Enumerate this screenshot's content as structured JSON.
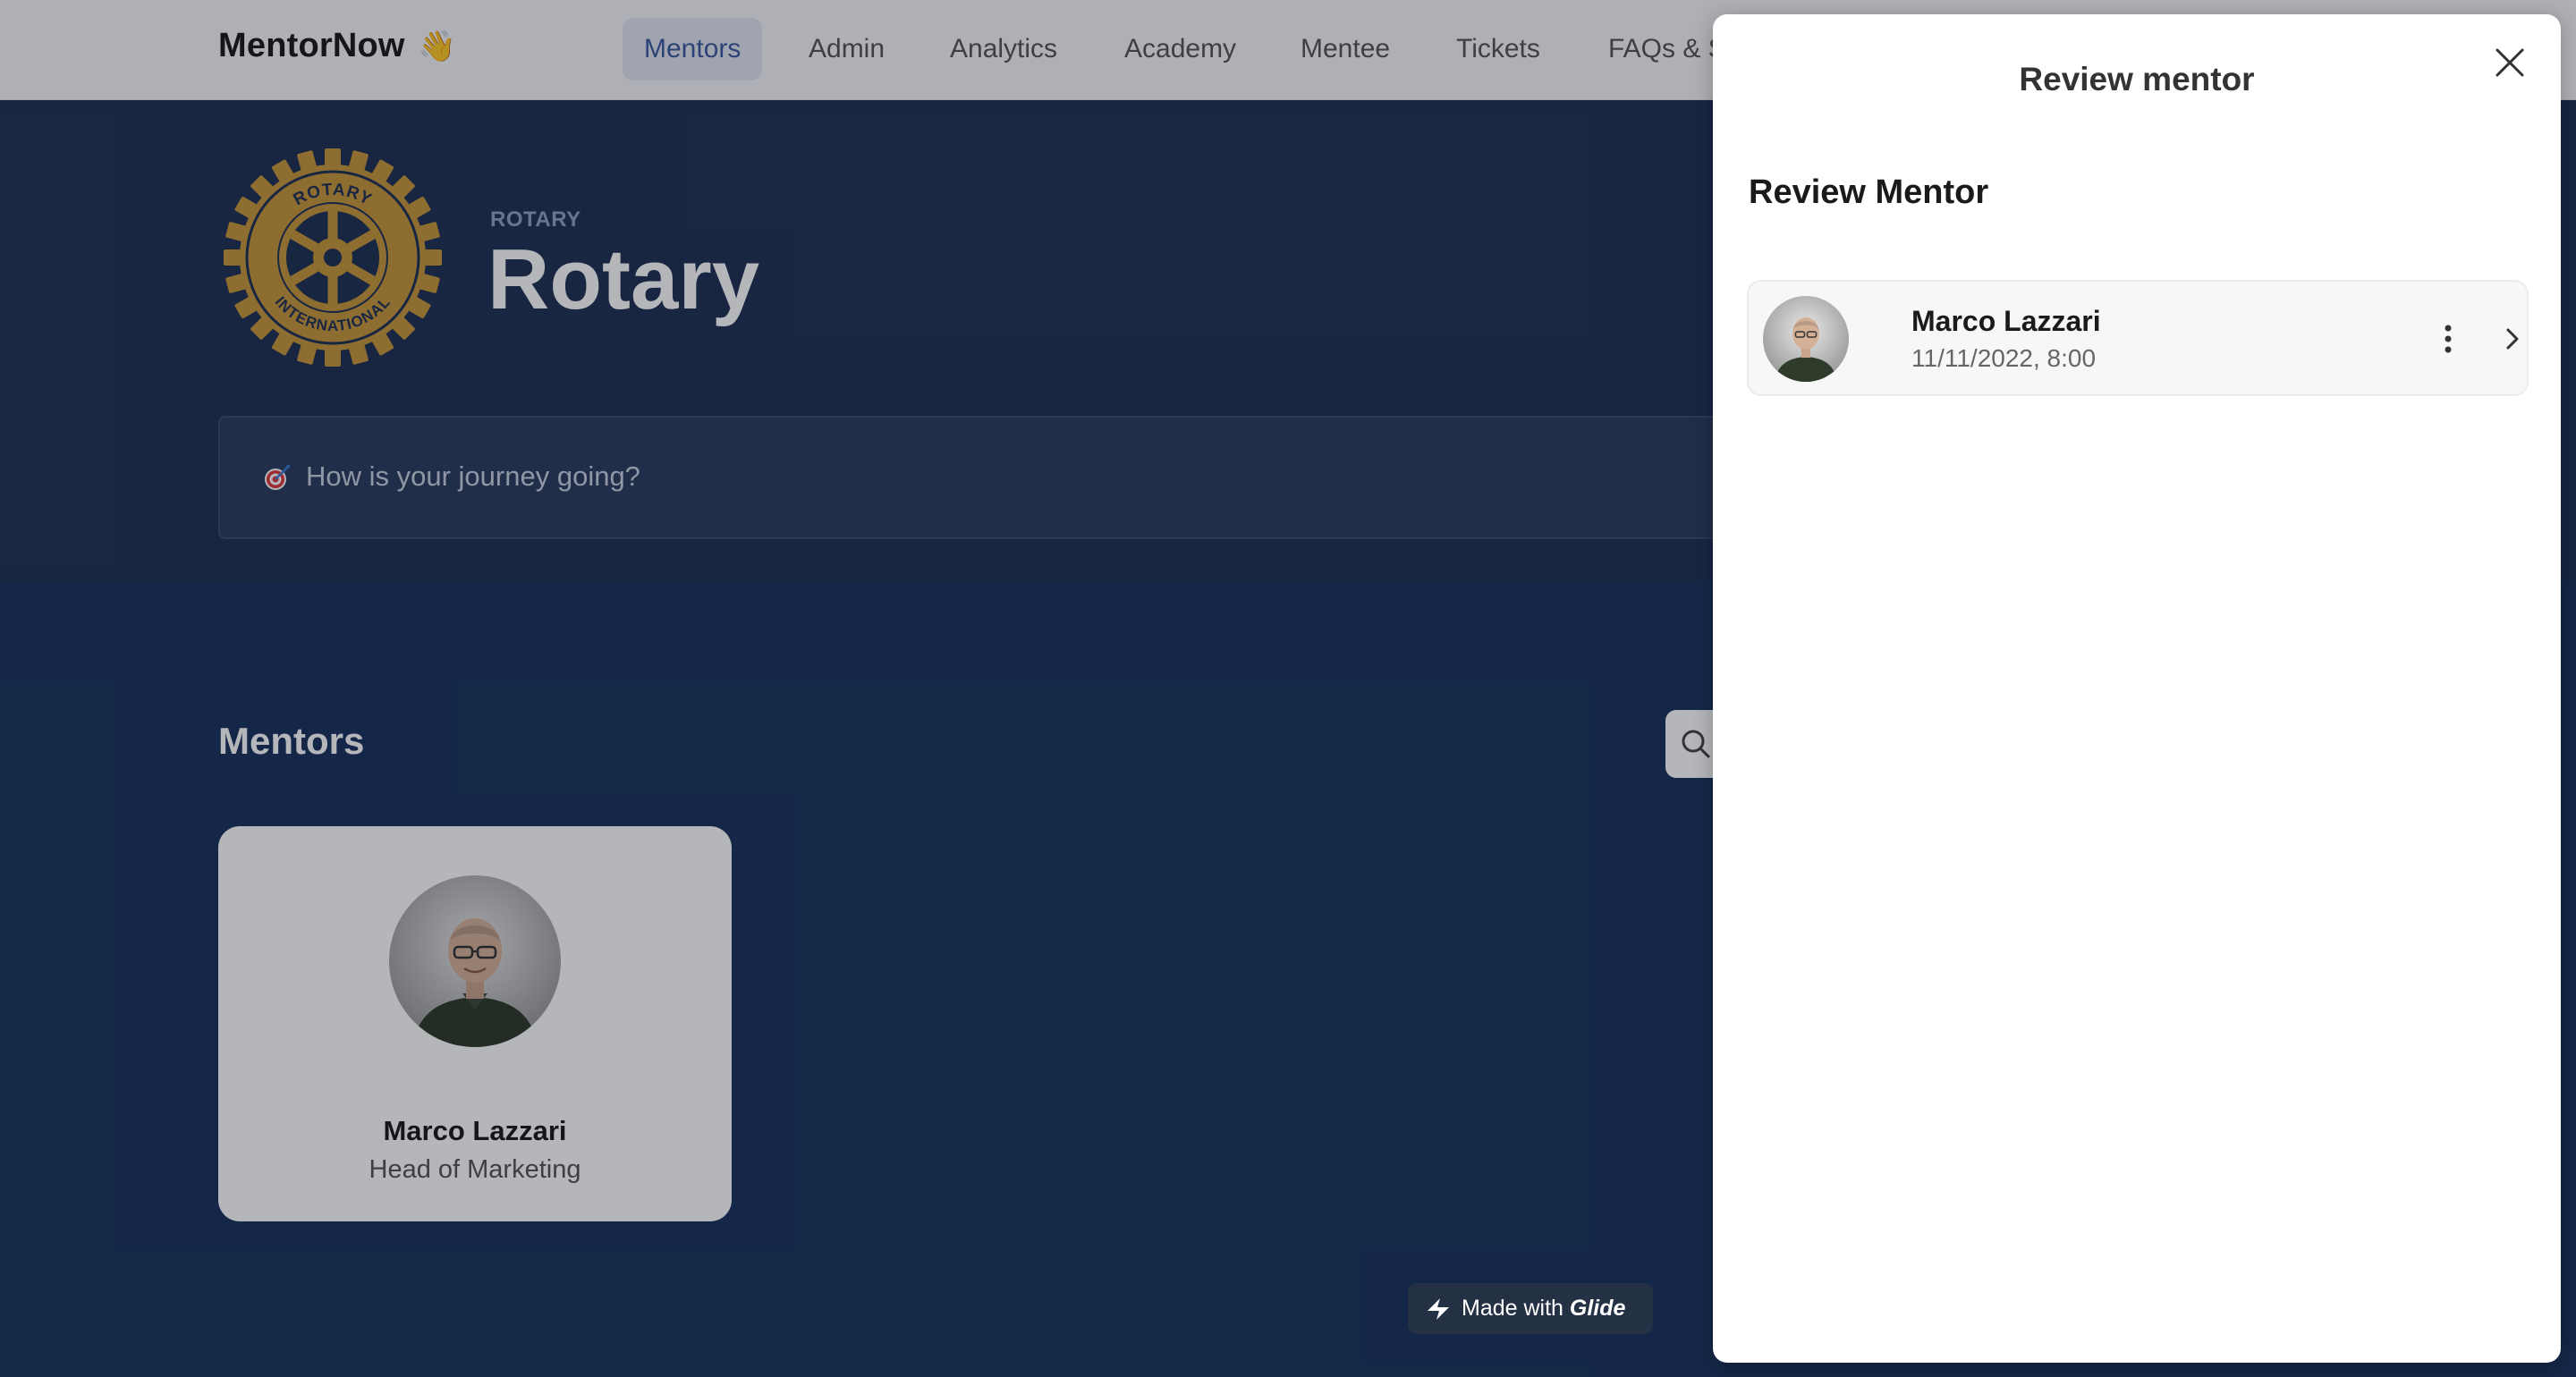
{
  "app": {
    "brand": "MentorNow",
    "brand_emoji": "👋"
  },
  "nav": {
    "items": [
      {
        "label": "Mentors",
        "active": true
      },
      {
        "label": "Admin"
      },
      {
        "label": "Analytics"
      },
      {
        "label": "Academy"
      },
      {
        "label": "Mentee"
      },
      {
        "label": "Tickets"
      },
      {
        "label": "FAQs & S"
      }
    ]
  },
  "org": {
    "kicker": "ROTARY",
    "title": "Rotary",
    "logo_icon": "rotary-wheel-logo",
    "logo_text_top": "ROTARY",
    "logo_text_bottom": "INTERNATIONAL"
  },
  "journey": {
    "icon": "dart-target-icon",
    "text": "How is your journey going?"
  },
  "mentors_section": {
    "title": "Mentors",
    "search_icon": "search-icon",
    "cards": [
      {
        "name": "Marco Lazzari",
        "role": "Head of Marketing"
      }
    ]
  },
  "panel": {
    "title": "Review mentor",
    "heading": "Review Mentor",
    "items": [
      {
        "name": "Marco Lazzari",
        "date": "11/11/2022, 8:00"
      }
    ]
  },
  "badge": {
    "prefix": "Made with",
    "brand": "Glide"
  },
  "colors": {
    "hero_bg": "#1f3254",
    "page_bg": "#19335c",
    "logo_gold": "#c8973a",
    "nav_active": "#3b5aa0"
  }
}
